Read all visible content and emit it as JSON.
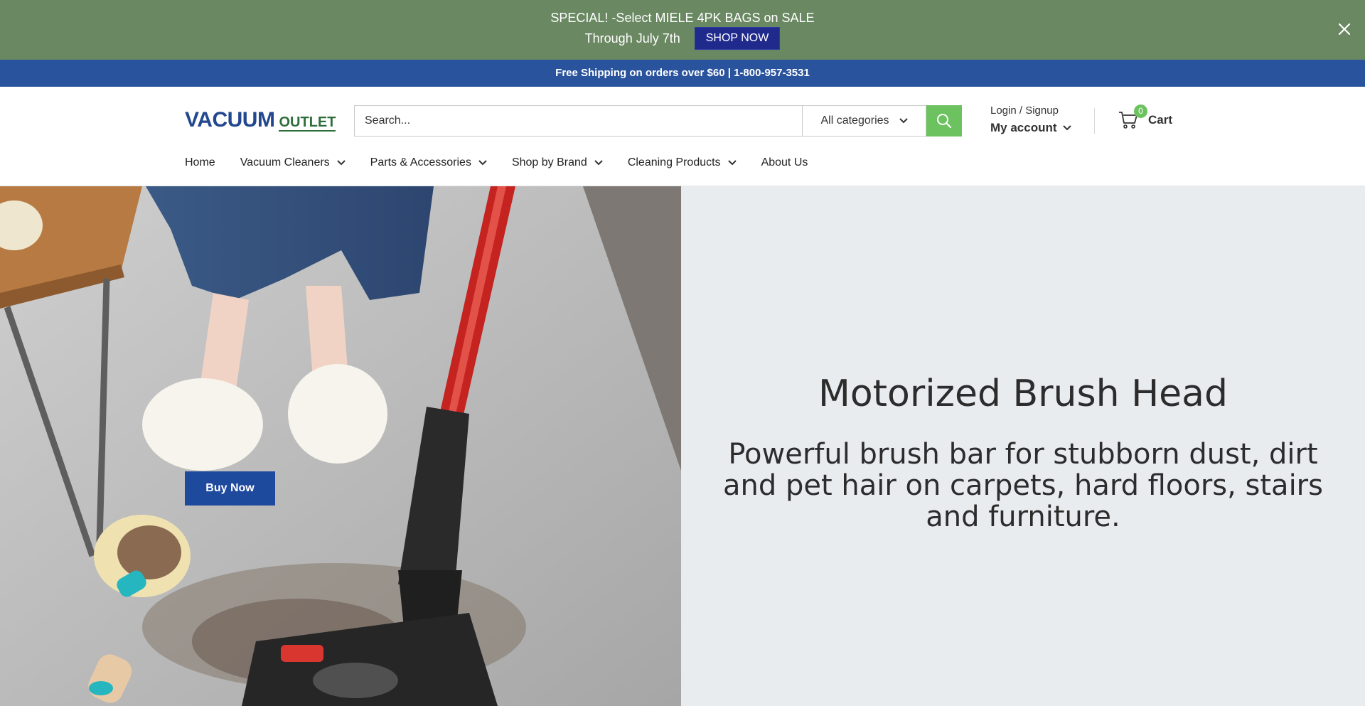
{
  "promo": {
    "line1": "SPECIAL! -Select MIELE 4PK BAGS on SALE",
    "line2": "Through July 7th",
    "shop_now": "SHOP NOW"
  },
  "shipping": {
    "text": "Free Shipping on orders over $60 | 1-800-957-3531"
  },
  "header": {
    "logo": {
      "part1": "VACUUM",
      "part2": "OUTLET"
    },
    "search": {
      "placeholder": "Search...",
      "category": "All categories"
    },
    "account": {
      "login": "Login / Signup",
      "my_account": "My account"
    },
    "cart": {
      "count": "0",
      "label": "Cart"
    }
  },
  "nav": {
    "items": [
      {
        "label": "Home"
      },
      {
        "label": "Vacuum Cleaners"
      },
      {
        "label": "Parts & Accessories"
      },
      {
        "label": "Shop by Brand"
      },
      {
        "label": "Cleaning Products"
      },
      {
        "label": "About Us"
      }
    ]
  },
  "hero": {
    "title": "Motorized Brush Head",
    "subtitle": "Powerful brush bar for stubborn dust, dirt and pet hair on carpets, hard floors, stairs and furniture.",
    "cta": "Buy Now"
  },
  "colors": {
    "promo_bg": "#6a8862",
    "shipping_bg": "#2a539e",
    "accent_green": "#6cc25f",
    "brand_blue": "#23478f"
  }
}
